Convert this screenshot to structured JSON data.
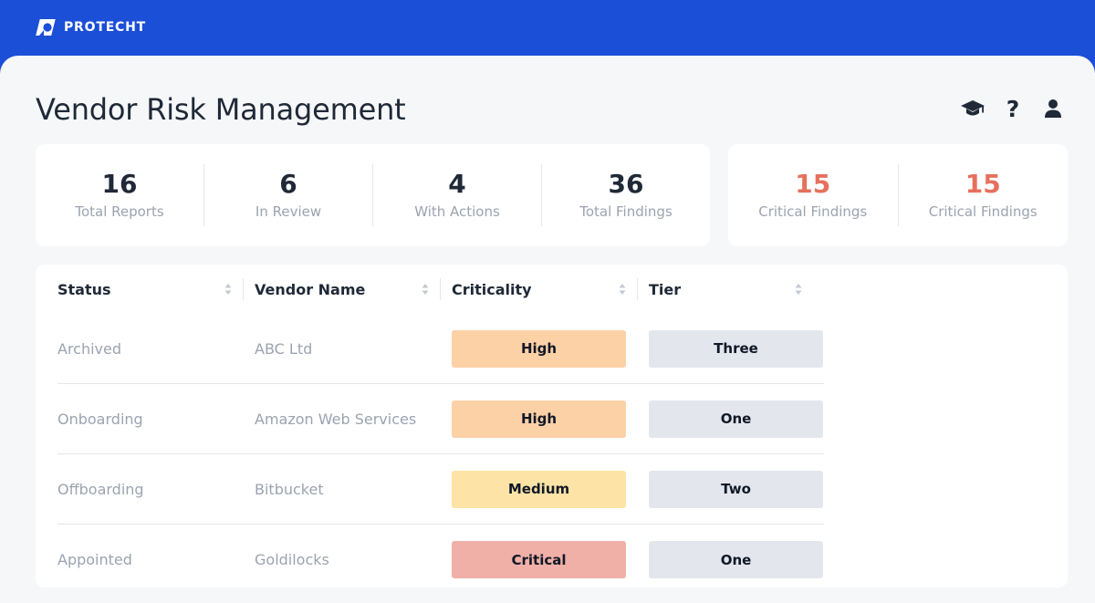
{
  "brand": {
    "name": "PROTECHT",
    "bar_color": "#1b4fd8"
  },
  "header": {
    "title": "Vendor Risk Management",
    "icons": [
      "graduation-cap-icon",
      "help-icon",
      "user-icon"
    ],
    "help_glyph": "?"
  },
  "stats": [
    {
      "value": "16",
      "label": "Total Reports"
    },
    {
      "value": "6",
      "label": "In Review"
    },
    {
      "value": "4",
      "label": "With Actions"
    },
    {
      "value": "36",
      "label": "Total Findings"
    }
  ],
  "critical_stats": [
    {
      "value": "15",
      "label": "Critical Findings"
    },
    {
      "value": "15",
      "label": "Critical Findings"
    }
  ],
  "table": {
    "columns": [
      "Status",
      "Vendor Name",
      "Criticality",
      "Tier"
    ],
    "rows": [
      {
        "status": "Archived",
        "vendor": "ABC Ltd",
        "criticality": "High",
        "tier": "Three"
      },
      {
        "status": "Onboarding",
        "vendor": "Amazon Web Services",
        "criticality": "High",
        "tier": "One"
      },
      {
        "status": "Offboarding",
        "vendor": "Bitbucket",
        "criticality": "Medium",
        "tier": "Two"
      },
      {
        "status": "Appointed",
        "vendor": "Goldilocks",
        "criticality": "Critical",
        "tier": "One"
      }
    ]
  },
  "colors": {
    "criticality": {
      "High": "#fdd1a6",
      "Medium": "#fde4a6",
      "Critical": "#f0b0a7"
    },
    "tier": "#e3e7ed",
    "critical_text": "#e5715d"
  }
}
